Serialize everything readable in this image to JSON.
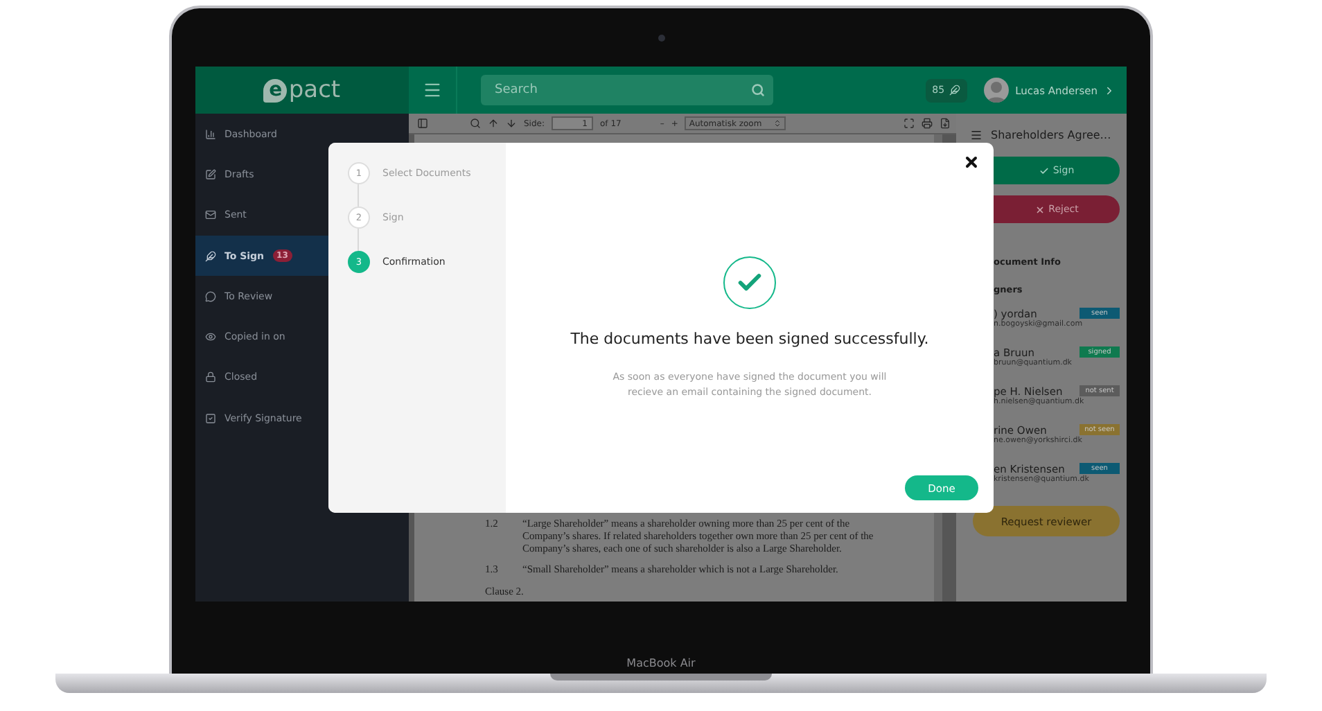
{
  "device": {
    "label": "MacBook Air"
  },
  "topbar": {
    "logo": {
      "mark": "e",
      "text": "pact"
    },
    "search": {
      "placeholder": "Search"
    },
    "credits": "85",
    "user": "Lucas Andersen"
  },
  "sidebar": {
    "items": [
      {
        "label": "Dashboard",
        "selected": false
      },
      {
        "label": "Drafts",
        "selected": false
      },
      {
        "label": "Sent",
        "selected": false
      },
      {
        "label": "To Sign",
        "badge": "13",
        "selected": true
      },
      {
        "label": "To Review",
        "selected": false
      },
      {
        "label": "Copied in on",
        "selected": false
      },
      {
        "label": "Closed",
        "selected": false
      },
      {
        "label": "Verify Signature",
        "selected": false
      }
    ]
  },
  "viewer": {
    "toolbar": {
      "page_label": "Side:",
      "page": "1",
      "page_count": "of 17",
      "zoom_out": "–",
      "zoom_in": "+",
      "zoom": "Automatisk zoom"
    },
    "paragraphs": [
      {
        "number": "1.2",
        "text": "“Large Shareholder” means a shareholder owning more than 25 per cent of the Company’s shares. If related shareholders together own more than 25 per cent of the Company’s shares, each one of such shareholder is also a Large Shareholder."
      },
      {
        "number": "1.3",
        "text": "“Small Shareholder” means a shareholder which is not a Large Shareholder."
      }
    ],
    "heading": "Clause 2."
  },
  "panel": {
    "title": "Shareholders Agree…",
    "sign": "Sign",
    "reject": "Reject",
    "info_heading": "ocument Info",
    "signers_heading": "gners",
    "signers": [
      {
        "name": ") yordan",
        "email": "n.bogoyski@gmail.com",
        "status": "seen",
        "color": "#0d5a73"
      },
      {
        "name": "a Bruun",
        "email": "bruun@quantium.dk",
        "status": "signed",
        "color": "#0f7a4f"
      },
      {
        "name": "pe H. Nielsen",
        "email": "h.nielsen@quantium.dk",
        "status": "not sent",
        "color": "#5c5c5c"
      },
      {
        "name": "rine Owen",
        "email": "ne.owen@yorkshirci.dk",
        "status": "not seen",
        "color": "#8a7230"
      },
      {
        "name": "en Kristensen",
        "email": "kristensen@quantium.dk",
        "status": "seen",
        "color": "#0d5a73"
      }
    ],
    "request": "Request reviewer"
  },
  "modal": {
    "steps": [
      {
        "number": "1",
        "label": "Select Documents",
        "selected": false
      },
      {
        "number": "2",
        "label": "Sign",
        "selected": false
      },
      {
        "number": "3",
        "label": "Confirmation",
        "selected": true
      }
    ],
    "title": "The documents have been signed successfully.",
    "message": "As soon as everyone have signed the document you will recieve an email containing the signed document.",
    "done": "Done"
  }
}
